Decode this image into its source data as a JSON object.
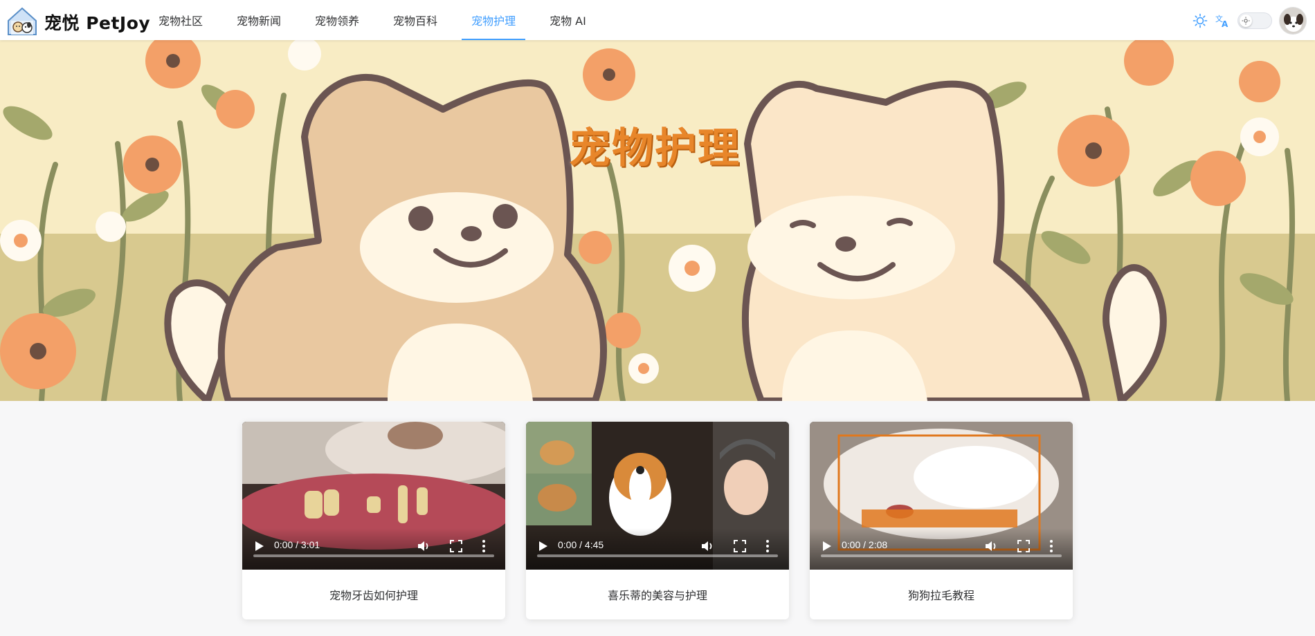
{
  "header": {
    "brand": "宠悦 PetJoy",
    "nav": [
      {
        "label": "宠物社区"
      },
      {
        "label": "宠物新闻"
      },
      {
        "label": "宠物领养"
      },
      {
        "label": "宠物百科"
      },
      {
        "label": "宠物护理",
        "active": true
      },
      {
        "label": "宠物 AI"
      }
    ],
    "icons": [
      "sun-icon",
      "translate-icon",
      "theme-toggle",
      "user-avatar"
    ],
    "accent": "#409eff"
  },
  "banner": {
    "title": "宠物护理"
  },
  "videos": [
    {
      "title": "宠物牙齿如何护理",
      "time": "0:00 / 3:01",
      "progress": 0
    },
    {
      "title": "喜乐蒂的美容与护理",
      "time": "0:00 / 4:45",
      "progress": 0
    },
    {
      "title": "狗狗拉毛教程",
      "time": "0:00 / 2:08",
      "progress": 0
    }
  ]
}
